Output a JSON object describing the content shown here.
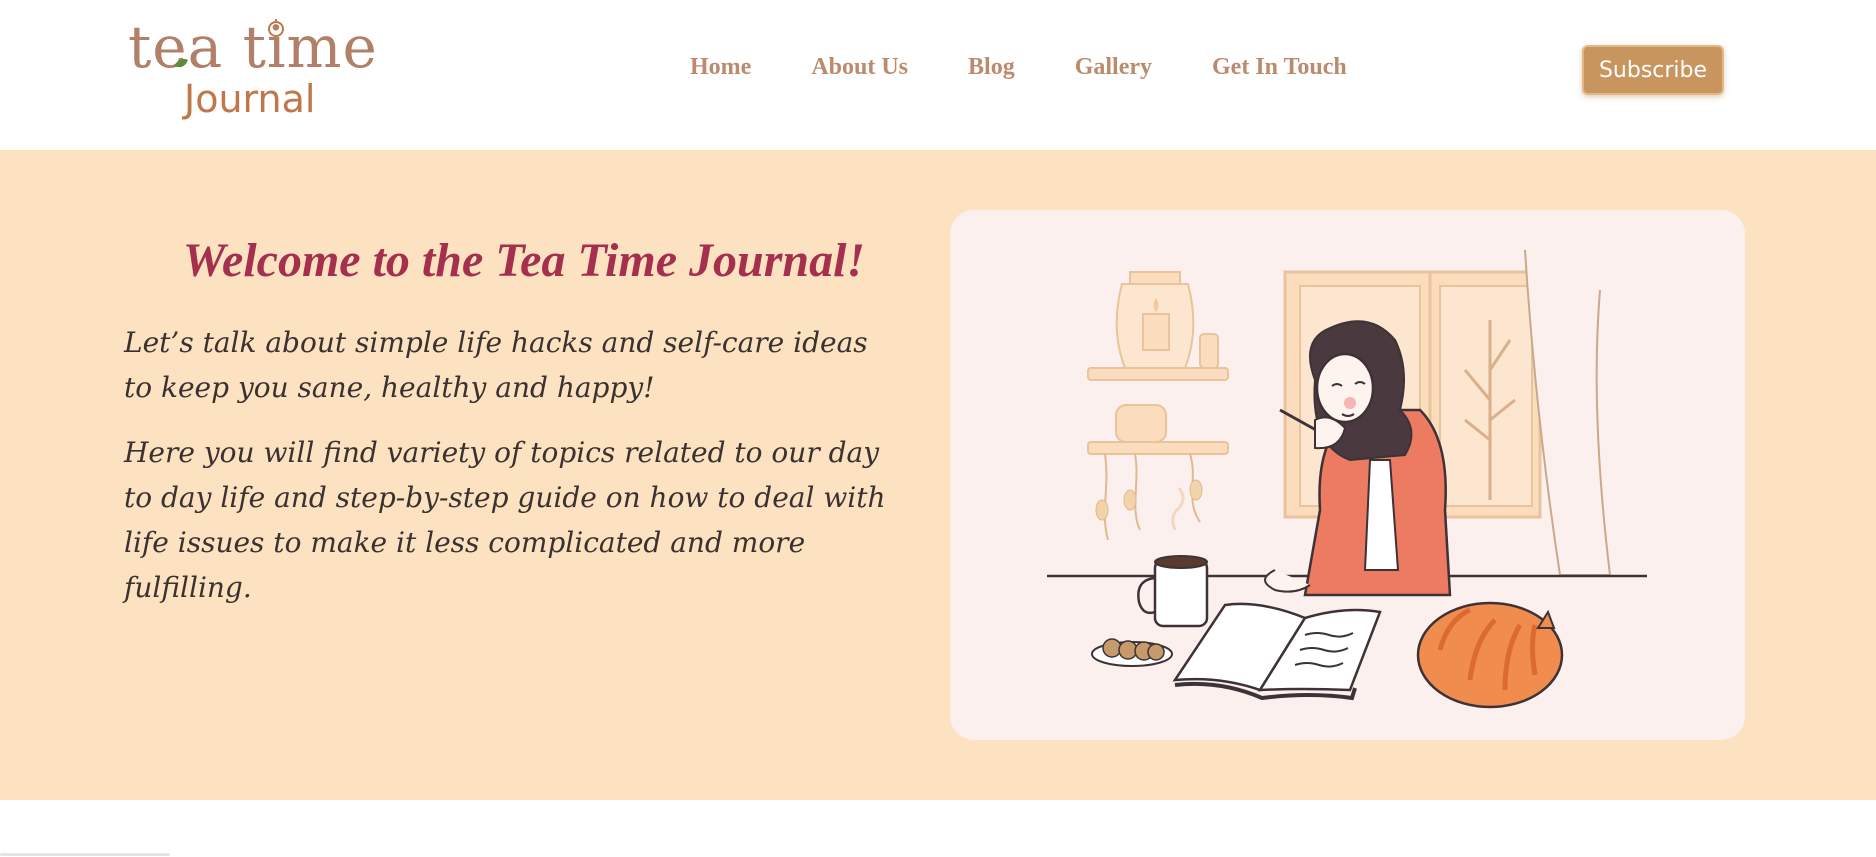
{
  "logo": {
    "line1": "tea time",
    "line2": "Journal"
  },
  "nav": {
    "items": [
      {
        "label": "Home"
      },
      {
        "label": "About Us"
      },
      {
        "label": "Blog"
      },
      {
        "label": "Gallery"
      },
      {
        "label": "Get In Touch"
      }
    ],
    "subscribe_label": "Subscribe"
  },
  "hero": {
    "title": "Welcome to the Tea Time Journal!",
    "paragraph1": "Let’s talk about simple life hacks and self-care ideas to keep you sane, healthy and happy!",
    "paragraph2": "Here you will find variety of topics related to our day to day life and step-by-step guide on how to deal with life issues to make it less complicated and more fulfilling."
  },
  "colors": {
    "hero_background": "#fde2c1",
    "title": "#a4304e",
    "nav_link": "#bc8a6c",
    "subscribe_button": "#c8955f",
    "card_background": "#fcf0ef"
  },
  "illustration": {
    "subject": "woman-writing-journal-with-tea-and-cat-icon"
  }
}
